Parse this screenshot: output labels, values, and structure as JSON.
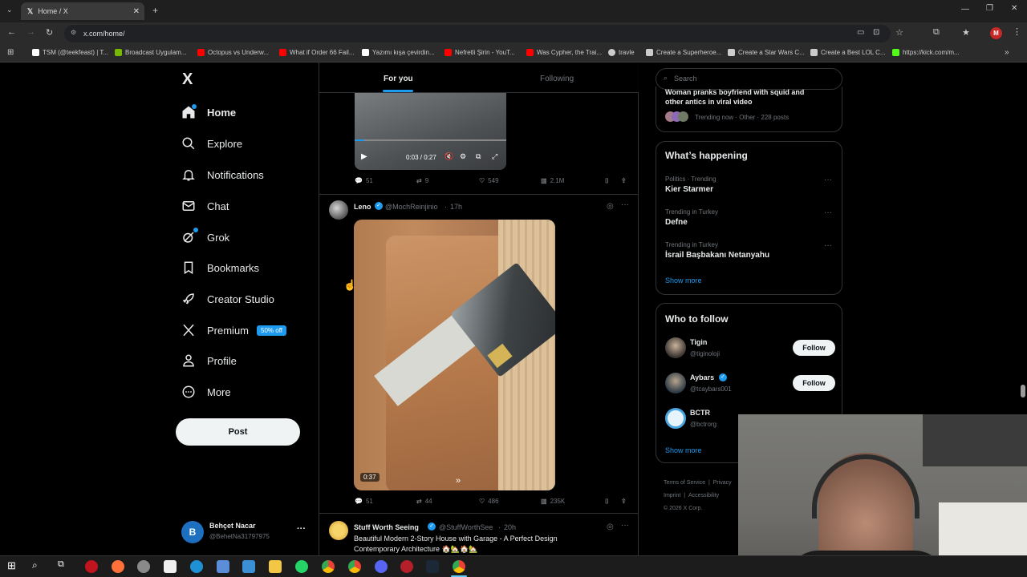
{
  "browser": {
    "tab_title": "Home / X",
    "url": "x.com/home/",
    "bookmarks": [
      {
        "label": "TSM (@teekfeast) | T...",
        "color": "#ffffff"
      },
      {
        "label": "Broadcast Uygulam...",
        "color": "#76b900"
      },
      {
        "label": "Octopus vs Underw...",
        "color": "#ff0000"
      },
      {
        "label": "What if Order 66 Fail...",
        "color": "#ff0000"
      },
      {
        "label": "Yazımı kışa çevirdin...",
        "color": "#ffffff"
      },
      {
        "label": "Nefretli Şirin - YouT...",
        "color": "#ff0000"
      },
      {
        "label": "Was Cypher, the Trai...",
        "color": "#ff0000"
      },
      {
        "label": "travle",
        "color": "#cccccc"
      },
      {
        "label": "Create a Superheroe...",
        "color": "#cccccc"
      },
      {
        "label": "Create a Star Wars C...",
        "color": "#cccccc"
      },
      {
        "label": "Create a Best LOL C...",
        "color": "#cccccc"
      },
      {
        "label": "https://kick.com/m...",
        "color": "#53fc18"
      }
    ],
    "profile_initial": "M"
  },
  "sidebar": {
    "logo": "X",
    "items": [
      {
        "label": "Home",
        "icon": "home-icon"
      },
      {
        "label": "Explore",
        "icon": "search-icon"
      },
      {
        "label": "Notifications",
        "icon": "bell-icon"
      },
      {
        "label": "Chat",
        "icon": "mail-icon"
      },
      {
        "label": "Grok",
        "icon": "grok-icon"
      },
      {
        "label": "Bookmarks",
        "icon": "bookmark-icon"
      },
      {
        "label": "Creator Studio",
        "icon": "rocket-icon"
      },
      {
        "label": "Premium",
        "icon": "x-icon",
        "badge": "50% off"
      },
      {
        "label": "Profile",
        "icon": "person-icon"
      },
      {
        "label": "More",
        "icon": "more-circle-icon"
      }
    ],
    "post_label": "Post",
    "account": {
      "initial": "B",
      "name": "Behçet Nacar",
      "handle": "@BehetNa31797975"
    }
  },
  "feed": {
    "tabs": [
      "For you",
      "Following"
    ],
    "video1": {
      "time": "0:03 / 0:27"
    },
    "tweet1_actions": {
      "replies": "51",
      "reposts": "9",
      "likes": "549",
      "views": "2.1M"
    },
    "tweet2": {
      "name": "Leno",
      "handle": "@MochReinjinio",
      "time": "17h",
      "duration": "0:37",
      "actions": {
        "replies": "51",
        "reposts": "44",
        "likes": "486",
        "views": "235K"
      }
    },
    "tweet3": {
      "name": "Stuff Worth Seeing",
      "handle": "@StuffWorthSee",
      "time": "20h",
      "text_line1": "Beautiful Modern 2-Story House with Garage - A Perfect Design",
      "text_line2": "Contemporary Architecture 🏠🏡🏠🏡"
    }
  },
  "right": {
    "search_placeholder": "Search",
    "top_trend": {
      "line1": "Woman pranks boyfriend with squid and",
      "line2": "other antics in viral video",
      "meta": "Trending now · Other · 228 posts"
    },
    "whats_happening": {
      "title": "What’s happening",
      "trends": [
        {
          "context": "Politics · Trending",
          "name": "Kier Starmer"
        },
        {
          "context": "Trending in Turkey",
          "name": "Defne"
        },
        {
          "context": "Trending in Turkey",
          "name": "İsrail Başbakanı Netanyahu"
        }
      ],
      "show_more": "Show more"
    },
    "who_to_follow": {
      "title": "Who to follow",
      "users": [
        {
          "name": "Tigin",
          "handle": "@tiginoloji",
          "verified": false
        },
        {
          "name": "Aybars",
          "handle": "@tcaybars001",
          "verified": true
        },
        {
          "name": "BCTR",
          "handle": "@bctrorg",
          "verified": false
        }
      ],
      "follow_label": "Follow",
      "show_more": "Show more"
    },
    "footer": {
      "terms": "Terms of Service",
      "privacy": "Privacy",
      "imprint": "Imprint",
      "accessibility": "Accessibility",
      "copyright": "© 2026 X Corp."
    }
  },
  "colors": {
    "accent": "#1d9bf0",
    "bg": "#000000",
    "border": "#2f3336",
    "muted": "#71767b"
  }
}
